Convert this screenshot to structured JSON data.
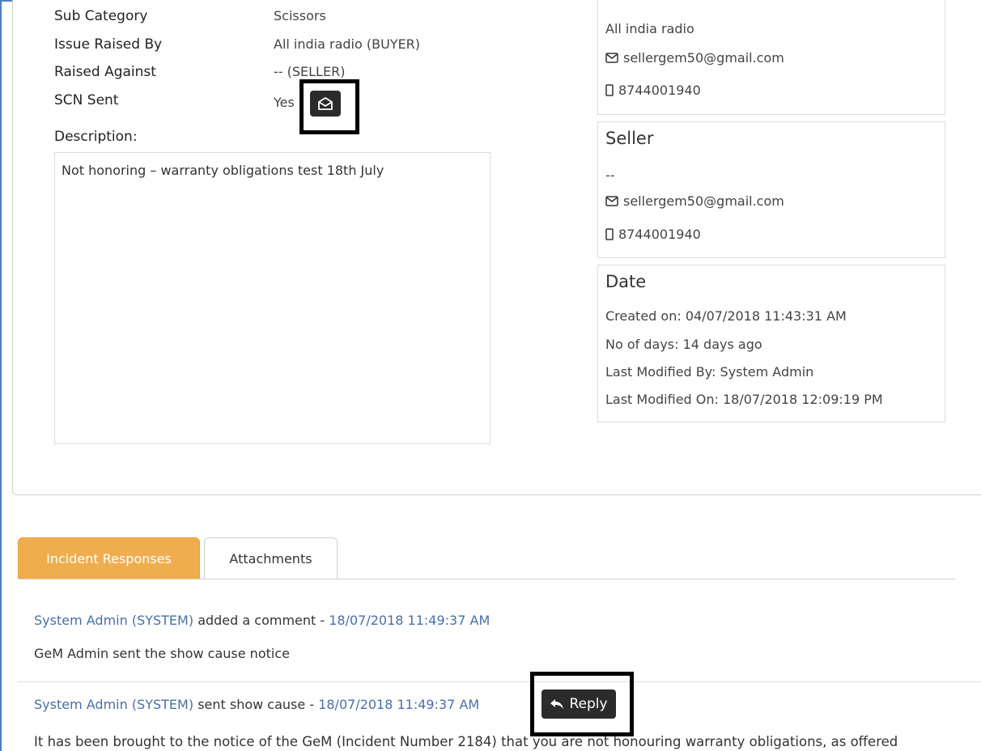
{
  "details": {
    "sub_category_label": "Sub Category",
    "sub_category_value": "Scissors",
    "issue_raised_by_label": "Issue Raised By",
    "issue_raised_by_value": "All india radio (BUYER)",
    "raised_against_label": "Raised Against",
    "raised_against_value": "-- (SELLER)",
    "scn_sent_label": "SCN Sent",
    "scn_sent_value": "Yes",
    "description_label": "Description:",
    "description_text": "Not honoring – warranty obligations test 18th July"
  },
  "buyer_card": {
    "name": "All india radio",
    "email": "sellergem50@gmail.com",
    "phone": "8744001940"
  },
  "seller_card": {
    "title": "Seller",
    "name": "--",
    "email": "sellergem50@gmail.com",
    "phone": "8744001940"
  },
  "date_card": {
    "title": "Date",
    "created_on": "Created on: 04/07/2018 11:43:31 AM",
    "no_of_days": "No of days: 14 days ago",
    "last_modified_by": "Last Modified By: System Admin",
    "last_modified_on": "Last Modified On: 18/07/2018 12:09:19 PM"
  },
  "tabs": [
    {
      "label": "Incident Responses",
      "active": true
    },
    {
      "label": "Attachments",
      "active": false
    }
  ],
  "responses": [
    {
      "author": "System Admin (SYSTEM)",
      "action": "added a comment -",
      "timestamp": "18/07/2018 11:49:37 AM",
      "body": "GeM Admin sent the show cause notice"
    },
    {
      "author": "System Admin (SYSTEM)",
      "action": "sent show cause -",
      "timestamp": "18/07/2018 11:49:37 AM",
      "reply_label": "Reply",
      "body": "It has been brought to the notice of the GeM (Incident Number 2184) that you are not honouring warranty obligations, as offered"
    }
  ],
  "colors": {
    "accent": "#f0ad4e",
    "link": "#4a6fa5",
    "dark_button": "#2b2b2b"
  },
  "icons": [
    "envelope-open-icon",
    "envelope-icon",
    "mobile-icon",
    "reply-icon"
  ]
}
